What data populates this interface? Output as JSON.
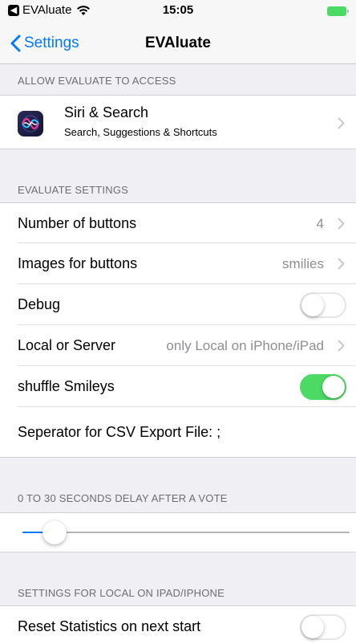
{
  "status_bar": {
    "back_app": "EVAluate",
    "time": "15:05",
    "wifi_icon": "wifi-icon",
    "battery_icon": "battery-icon"
  },
  "nav": {
    "back_label": "Settings",
    "title": "EVAluate",
    "accent_color": "#007aff"
  },
  "sections": {
    "access_header": "ALLOW EVALUATE TO ACCESS",
    "settings_header": "EVALUATE SETTINGS",
    "delay_header": "0 TO 30 SECONDS DELAY AFTER A VOTE",
    "local_header": "SETTINGS FOR LOCAL ON IPAD/IPHONE"
  },
  "siri": {
    "title": "Siri & Search",
    "subtitle": "Search, Suggestions & Shortcuts",
    "icon": "siri-icon"
  },
  "settings": {
    "number_of_buttons": {
      "label": "Number of buttons",
      "value": "4"
    },
    "images_for_buttons": {
      "label": "Images for buttons",
      "value": "smilies"
    },
    "debug": {
      "label": "Debug",
      "on": false
    },
    "local_or_server": {
      "label": "Local or Server",
      "value": "only Local on iPhone/iPad"
    },
    "shuffle_smileys": {
      "label": "shuffle Smileys",
      "on": true
    },
    "csv_separator": {
      "label": "Seperator for CSV Export File:  ;"
    }
  },
  "delay_slider": {
    "min": 0,
    "max": 30,
    "value": 2
  },
  "local": {
    "reset_statistics": {
      "label": "Reset Statistics on next start",
      "on": false
    }
  },
  "colors": {
    "toggle_on": "#4cd964",
    "background": "#efeff4"
  }
}
